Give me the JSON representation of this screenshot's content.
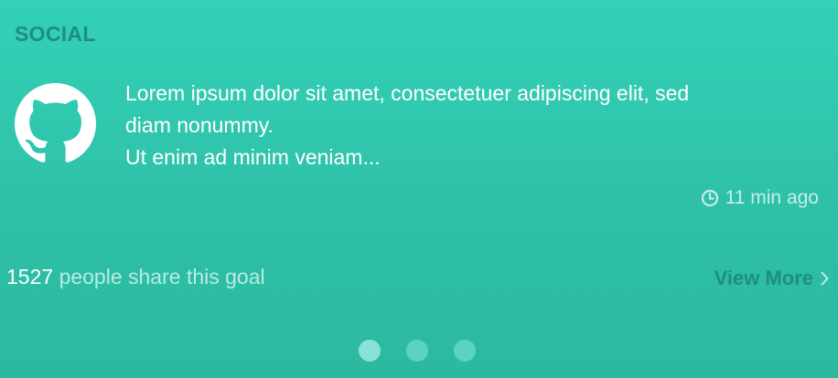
{
  "section": {
    "title": "SOCIAL"
  },
  "post": {
    "avatar_icon": "github-icon",
    "message_lines": [
      "Lorem ipsum dolor sit amet, consectetuer adipiscing elit, sed",
      "diam nonummy.",
      "Ut enim ad minim veniam..."
    ],
    "time_icon": "clock-icon",
    "time_ago": "11 min ago"
  },
  "footer": {
    "share_count": "1527",
    "share_text": "people share this goal",
    "view_more_label": "View More",
    "view_more_icon": "chevron-right-icon"
  },
  "pager": {
    "dots": 3,
    "active_index": 0
  },
  "colors": {
    "background_top": "#33d1b8",
    "background_bottom": "#2bb9a0",
    "accent_dark": "#1f8e80",
    "text_primary": "#ffffff",
    "text_muted": "#b8ece2"
  }
}
